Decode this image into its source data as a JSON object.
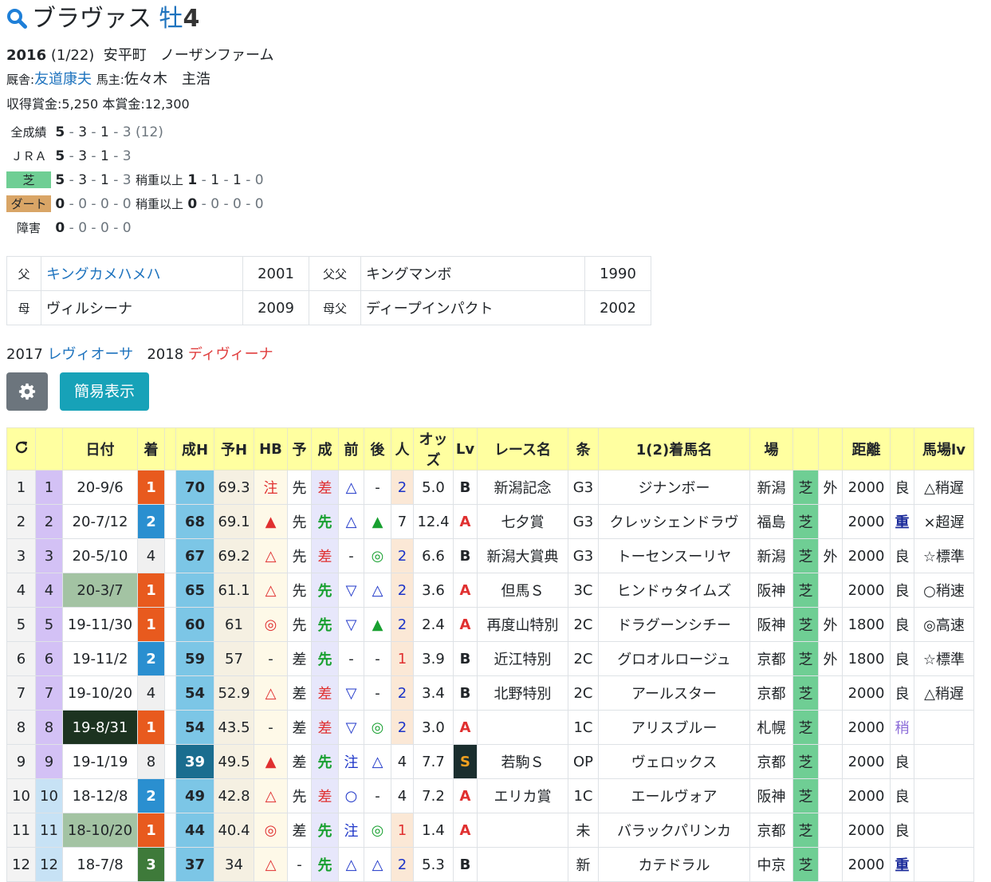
{
  "horse": {
    "name": "ブラヴァス",
    "sex_age": "牡",
    "age": "4",
    "birth_year": "2016",
    "birth_date": "(1/22)",
    "breeder_region": "安平町",
    "farm": "ノーザンファーム",
    "stable_label": "厩舎:",
    "trainer": "友道康夫",
    "owner_label": "馬主:",
    "owner": "佐々木　主浩",
    "earned_label": "収得賞金:",
    "earned": "5,250",
    "prize_label": "本賞金:",
    "prize": "12,300"
  },
  "records": [
    {
      "label": "全成績",
      "w": "5",
      "s": "3",
      "t": "1",
      "o": "3",
      "extra": "(12)"
    },
    {
      "label": "ＪＲＡ",
      "w": "5",
      "s": "3",
      "t": "1",
      "o": "3"
    },
    {
      "label": "芝",
      "w": "5",
      "s": "3",
      "t": "1",
      "o": "3",
      "hv_label": "稍重以上",
      "hw": "1",
      "hs": "1",
      "ht": "1",
      "ho": "0"
    },
    {
      "label": "ダート",
      "w": "0",
      "s": "0",
      "t": "0",
      "o": "0",
      "hv_label": "稍重以上",
      "hw": "0",
      "hs": "0",
      "ht": "0",
      "ho": "0"
    },
    {
      "label": "障害",
      "w": "0",
      "s": "0",
      "t": "0",
      "o": "0"
    }
  ],
  "pedigree": {
    "sire_label": "父",
    "sire": "キングカメハメハ",
    "sire_year": "2001",
    "sire_sire_label": "父父",
    "sire_sire": "キングマンボ",
    "sire_sire_year": "1990",
    "dam_label": "母",
    "dam": "ヴィルシーナ",
    "dam_year": "2009",
    "dam_sire_label": "母父",
    "dam_sire": "ディープインパクト",
    "dam_sire_year": "2002"
  },
  "offspring": [
    {
      "year": "2017",
      "name": "レヴィオーサ"
    },
    {
      "year": "2018",
      "name": "ディヴィーナ"
    }
  ],
  "buttons": {
    "simple_label": "簡易表示"
  },
  "table": {
    "headers": [
      "",
      "",
      "日付",
      "着",
      "",
      "成H",
      "予H",
      "HB",
      "予",
      "成",
      "前",
      "後",
      "人",
      "オッズ",
      "Lv",
      "レース名",
      "条",
      "1(2)着馬名",
      "場",
      "",
      "",
      "距離",
      "",
      "馬場lv"
    ],
    "rows": [
      {
        "n": "1",
        "i": "1",
        "date": "20-9/6",
        "rank": "1",
        "seiH": "70",
        "yoH": "69.3",
        "hb": "注",
        "yo": "先",
        "sei": "差",
        "mae": "△",
        "ato": "-",
        "pop": "2",
        "odds": "5.0",
        "lv": "B",
        "race": "新潟記念",
        "cls": "G3",
        "winner": "ジナンボー",
        "course": "新潟",
        "surf": "芝",
        "io": "外",
        "dist": "2000",
        "cond": "良",
        "blv": "△稍遅"
      },
      {
        "n": "2",
        "i": "2",
        "date": "20-7/12",
        "rank": "2",
        "seiH": "68",
        "yoH": "69.1",
        "hb": "▲",
        "yo": "先",
        "sei": "先",
        "mae": "△",
        "ato": "▲",
        "pop": "7",
        "odds": "12.4",
        "lv": "A",
        "race": "七夕賞",
        "cls": "G3",
        "winner": "クレッシェンドラヴ",
        "course": "福島",
        "surf": "芝",
        "io": "",
        "dist": "2000",
        "cond": "重",
        "blv": "×超遅"
      },
      {
        "n": "3",
        "i": "3",
        "date": "20-5/10",
        "rank": "4",
        "seiH": "67",
        "yoH": "69.2",
        "hb": "△",
        "yo": "先",
        "sei": "差",
        "mae": "-",
        "ato": "◎",
        "pop": "2",
        "odds": "6.6",
        "lv": "B",
        "race": "新潟大賞典",
        "cls": "G3",
        "winner": "トーセンスーリヤ",
        "course": "新潟",
        "surf": "芝",
        "io": "外",
        "dist": "2000",
        "cond": "良",
        "blv": "☆標準"
      },
      {
        "n": "4",
        "i": "4",
        "date": "20-3/7",
        "rank": "1",
        "seiH": "65",
        "yoH": "61.1",
        "hb": "△",
        "yo": "先",
        "sei": "先",
        "mae": "▽",
        "ato": "△",
        "pop": "2",
        "odds": "3.6",
        "lv": "A",
        "race": "但馬Ｓ",
        "cls": "3C",
        "winner": "ヒンドゥタイムズ",
        "course": "阪神",
        "surf": "芝",
        "io": "",
        "dist": "2000",
        "cond": "良",
        "blv": "○稍速"
      },
      {
        "n": "5",
        "i": "5",
        "date": "19-11/30",
        "rank": "1",
        "seiH": "60",
        "yoH": "61",
        "hb": "◎",
        "yo": "先",
        "sei": "先",
        "mae": "▽",
        "ato": "▲",
        "pop": "2",
        "odds": "2.4",
        "lv": "A",
        "race": "再度山特別",
        "cls": "2C",
        "winner": "ドラグーンシチー",
        "course": "阪神",
        "surf": "芝",
        "io": "外",
        "dist": "1800",
        "cond": "良",
        "blv": "◎高速"
      },
      {
        "n": "6",
        "i": "6",
        "date": "19-11/2",
        "rank": "2",
        "seiH": "59",
        "yoH": "57",
        "hb": "-",
        "yo": "差",
        "sei": "先",
        "mae": "-",
        "ato": "-",
        "pop": "1",
        "odds": "3.9",
        "lv": "B",
        "race": "近江特別",
        "cls": "2C",
        "winner": "グロオルロージュ",
        "course": "京都",
        "surf": "芝",
        "io": "外",
        "dist": "1800",
        "cond": "良",
        "blv": "☆標準"
      },
      {
        "n": "7",
        "i": "7",
        "date": "19-10/20",
        "rank": "4",
        "seiH": "54",
        "yoH": "52.9",
        "hb": "△",
        "yo": "差",
        "sei": "差",
        "mae": "▽",
        "ato": "-",
        "pop": "2",
        "odds": "3.4",
        "lv": "B",
        "race": "北野特別",
        "cls": "2C",
        "winner": "アールスター",
        "course": "京都",
        "surf": "芝",
        "io": "",
        "dist": "2000",
        "cond": "良",
        "blv": "△稍遅"
      },
      {
        "n": "8",
        "i": "8",
        "date": "19-8/31",
        "rank": "1",
        "seiH": "54",
        "yoH": "43.5",
        "hb": "-",
        "yo": "差",
        "sei": "差",
        "mae": "▽",
        "ato": "◎",
        "pop": "2",
        "odds": "3.0",
        "lv": "A",
        "race": "",
        "cls": "1C",
        "winner": "アリスブルー",
        "course": "札幌",
        "surf": "芝",
        "io": "",
        "dist": "2000",
        "cond": "稍",
        "blv": ""
      },
      {
        "n": "9",
        "i": "9",
        "date": "19-1/19",
        "rank": "8",
        "seiH": "39",
        "yoH": "49.5",
        "hb": "▲",
        "yo": "差",
        "sei": "先",
        "mae": "注",
        "ato": "△",
        "pop": "4",
        "odds": "7.7",
        "lv": "S",
        "race": "若駒Ｓ",
        "cls": "OP",
        "winner": "ヴェロックス",
        "course": "京都",
        "surf": "芝",
        "io": "",
        "dist": "2000",
        "cond": "良",
        "blv": ""
      },
      {
        "n": "10",
        "i": "10",
        "date": "18-12/8",
        "rank": "2",
        "seiH": "49",
        "yoH": "42.8",
        "hb": "△",
        "yo": "先",
        "sei": "差",
        "mae": "○",
        "ato": "-",
        "pop": "4",
        "odds": "7.2",
        "lv": "A",
        "race": "エリカ賞",
        "cls": "1C",
        "winner": "エールヴォア",
        "course": "阪神",
        "surf": "芝",
        "io": "",
        "dist": "2000",
        "cond": "良",
        "blv": ""
      },
      {
        "n": "11",
        "i": "11",
        "date": "18-10/20",
        "rank": "1",
        "seiH": "44",
        "yoH": "40.4",
        "hb": "◎",
        "yo": "差",
        "sei": "先",
        "mae": "注",
        "ato": "◎",
        "pop": "1",
        "odds": "1.4",
        "lv": "A",
        "race": "",
        "cls": "未",
        "winner": "バラックパリンカ",
        "course": "京都",
        "surf": "芝",
        "io": "",
        "dist": "2000",
        "cond": "良",
        "blv": ""
      },
      {
        "n": "12",
        "i": "12",
        "date": "18-7/8",
        "rank": "3",
        "seiH": "37",
        "yoH": "34",
        "hb": "△",
        "yo": "-",
        "sei": "先",
        "mae": "△",
        "ato": "△",
        "pop": "2",
        "odds": "5.3",
        "lv": "B",
        "race": "",
        "cls": "新",
        "winner": "カテドラル",
        "course": "中京",
        "surf": "芝",
        "io": "",
        "dist": "2000",
        "cond": "重",
        "blv": ""
      }
    ]
  }
}
